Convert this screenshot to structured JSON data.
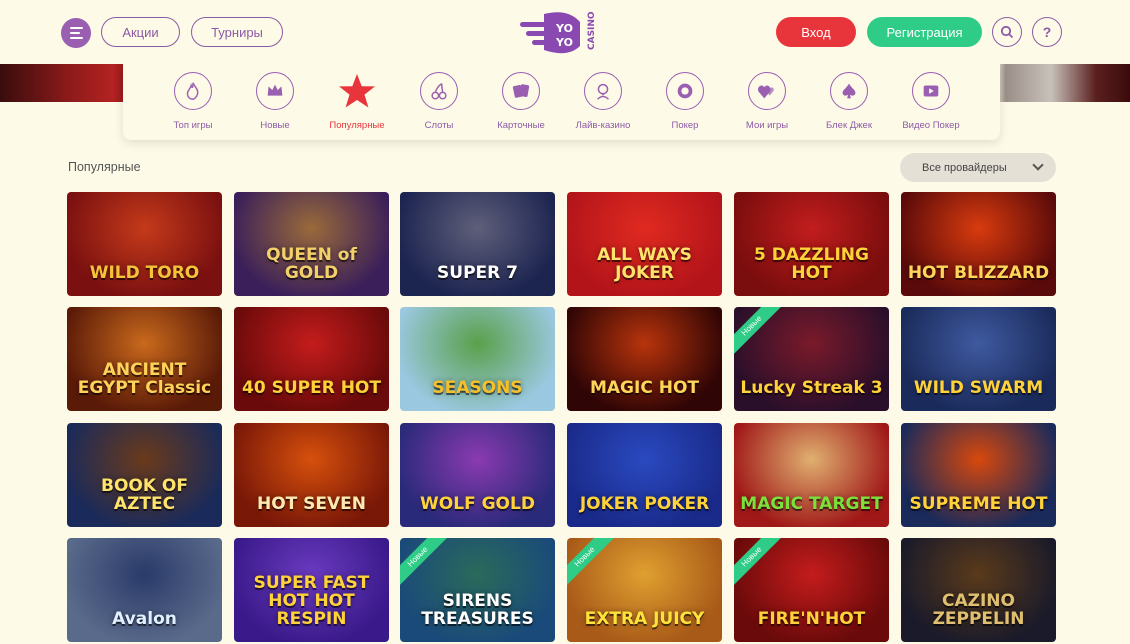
{
  "header": {
    "promo_label": "Акции",
    "tournaments_label": "Турниры",
    "logo_text": "YOYO CASINO",
    "login_label": "Вход",
    "register_label": "Регистрация",
    "help_label": "?"
  },
  "categories": [
    {
      "label": "Топ игры",
      "icon": "flame-icon",
      "active": false
    },
    {
      "label": "Новые",
      "icon": "crown-icon",
      "active": false
    },
    {
      "label": "Популярные",
      "icon": "star-icon",
      "active": true
    },
    {
      "label": "Слоты",
      "icon": "cherries-icon",
      "active": false
    },
    {
      "label": "Карточные",
      "icon": "cards-icon",
      "active": false
    },
    {
      "label": "Лайв-казино",
      "icon": "dealer-icon",
      "active": false
    },
    {
      "label": "Покер",
      "icon": "poker-chip-icon",
      "active": false
    },
    {
      "label": "Мои игры",
      "icon": "hearts-icon",
      "active": false
    },
    {
      "label": "Блек Джек",
      "icon": "spade-icon",
      "active": false
    },
    {
      "label": "Видео Покер",
      "icon": "video-play-icon",
      "active": false
    }
  ],
  "section": {
    "title": "Популярные",
    "provider_filter": "Все провайдеры"
  },
  "badge_new_label": "Новые",
  "games": [
    {
      "title": "WILD TORO",
      "bg": "#7a1010",
      "bg2": "#c43a1a",
      "fg": "#f5c23a",
      "new": false
    },
    {
      "title": "QUEEN of GOLD",
      "bg": "#3a1f5a",
      "bg2": "#9a6a3a",
      "fg": "#f3d06a",
      "new": false
    },
    {
      "title": "SUPER 7",
      "bg": "#1c2450",
      "bg2": "#5f5f7a",
      "fg": "#ffffff",
      "new": false
    },
    {
      "title": "ALL WAYS JOKER",
      "bg": "#b3141a",
      "bg2": "#e02a20",
      "fg": "#ffe36a",
      "new": false
    },
    {
      "title": "5 DAZZLING HOT",
      "bg": "#7a0d0d",
      "bg2": "#c21d1d",
      "fg": "#ffd23a",
      "new": false
    },
    {
      "title": "HOT BLIZZARD",
      "bg": "#5a0a0a",
      "bg2": "#d83b0e",
      "fg": "#ffd65a",
      "new": false
    },
    {
      "title": "ANCIENT EGYPT Classic",
      "bg": "#5a1a08",
      "bg2": "#c9691c",
      "fg": "#ffd25a",
      "new": false
    },
    {
      "title": "40 SUPER HOT",
      "bg": "#6a0a0a",
      "bg2": "#c41c1c",
      "fg": "#ffd23a",
      "new": false
    },
    {
      "title": "SEASONS",
      "bg": "#9ac8e0",
      "bg2": "#5aa04a",
      "fg": "#f6c02a",
      "new": false
    },
    {
      "title": "MAGIC HOT",
      "bg": "#300505",
      "bg2": "#b8340c",
      "fg": "#ffd65a",
      "new": false
    },
    {
      "title": "Lucky Streak 3",
      "bg": "#2a0f2a",
      "bg2": "#7a1a2a",
      "fg": "#ffd23a",
      "new": true
    },
    {
      "title": "WILD SWARM",
      "bg": "#1a2a5a",
      "bg2": "#3f5aa0",
      "fg": "#ffd23a",
      "new": false
    },
    {
      "title": "BOOK OF AZTEC",
      "bg": "#1a2a5a",
      "bg2": "#6a3a1a",
      "fg": "#ffe36a",
      "new": false
    },
    {
      "title": "HOT SEVEN",
      "bg": "#7a1808",
      "bg2": "#d6500c",
      "fg": "#ffe9b0",
      "new": false
    },
    {
      "title": "WOLF GOLD",
      "bg": "#2a2a7a",
      "bg2": "#8a3ab0",
      "fg": "#ffd23a",
      "new": false
    },
    {
      "title": "JOKER POKER",
      "bg": "#1a2a8a",
      "bg2": "#2a4ac0",
      "fg": "#ffd23a",
      "new": false
    },
    {
      "title": "MAGIC TARGET",
      "bg": "#a01818",
      "bg2": "#e0b070",
      "fg": "#7ae03a",
      "new": false
    },
    {
      "title": "SUPREME HOT",
      "bg": "#1a2a5a",
      "bg2": "#d8480c",
      "fg": "#ffd23a",
      "new": false
    },
    {
      "title": "Avalon",
      "bg": "#5a6a8a",
      "bg2": "#2a3a6a",
      "fg": "#e0f0ff",
      "new": false
    },
    {
      "title": "SUPER FAST HOT HOT RESPIN",
      "bg": "#3a1a8a",
      "bg2": "#6a3ac0",
      "fg": "#ffd23a",
      "new": false
    },
    {
      "title": "SIRENS TREASURES",
      "bg": "#1a4a7a",
      "bg2": "#2a6a5a",
      "fg": "#ffffff",
      "new": true
    },
    {
      "title": "EXTRA JUICY",
      "bg": "#a85a18",
      "bg2": "#e0a030",
      "fg": "#ffe23a",
      "new": true
    },
    {
      "title": "FIRE'N'HOT",
      "bg": "#6a0a0a",
      "bg2": "#c41c1c",
      "fg": "#ffd23a",
      "new": true
    },
    {
      "title": "CAZINO ZEPPELIN",
      "bg": "#1a1a2a",
      "bg2": "#5a3a1a",
      "fg": "#e0c070",
      "new": false
    }
  ]
}
